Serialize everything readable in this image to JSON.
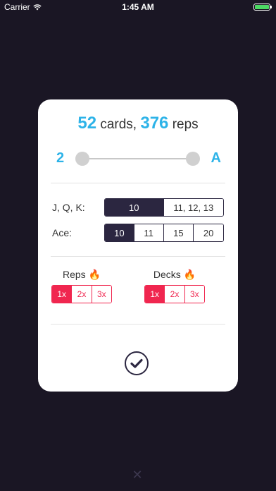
{
  "status_bar": {
    "carrier": "Carrier",
    "time": "1:45 AM",
    "battery_level": 1.0,
    "battery_color": "#4cd964"
  },
  "summary": {
    "cards_count": "52",
    "cards_word": "cards,",
    "reps_count": "376",
    "reps_word": "reps"
  },
  "range_slider": {
    "min_label": "2",
    "max_label": "A"
  },
  "face_cards": {
    "label": "J, Q, K:",
    "options": [
      "10",
      "11, 12, 13"
    ],
    "selected": "10"
  },
  "ace": {
    "label": "Ace:",
    "options": [
      "10",
      "11",
      "15",
      "20"
    ],
    "selected": "10"
  },
  "reps": {
    "label": "Reps",
    "icon": "fire-icon",
    "options": [
      "1x",
      "2x",
      "3x"
    ],
    "selected": "1x"
  },
  "decks": {
    "label": "Decks",
    "icon": "fire-icon",
    "options": [
      "1x",
      "2x",
      "3x"
    ],
    "selected": "1x"
  },
  "confirm_icon": "checkmark-icon",
  "close_icon": "close-icon",
  "colors": {
    "background": "#1a1624",
    "accent_blue": "#2db3e8",
    "accent_red": "#f0264f",
    "dark": "#2b2640"
  }
}
